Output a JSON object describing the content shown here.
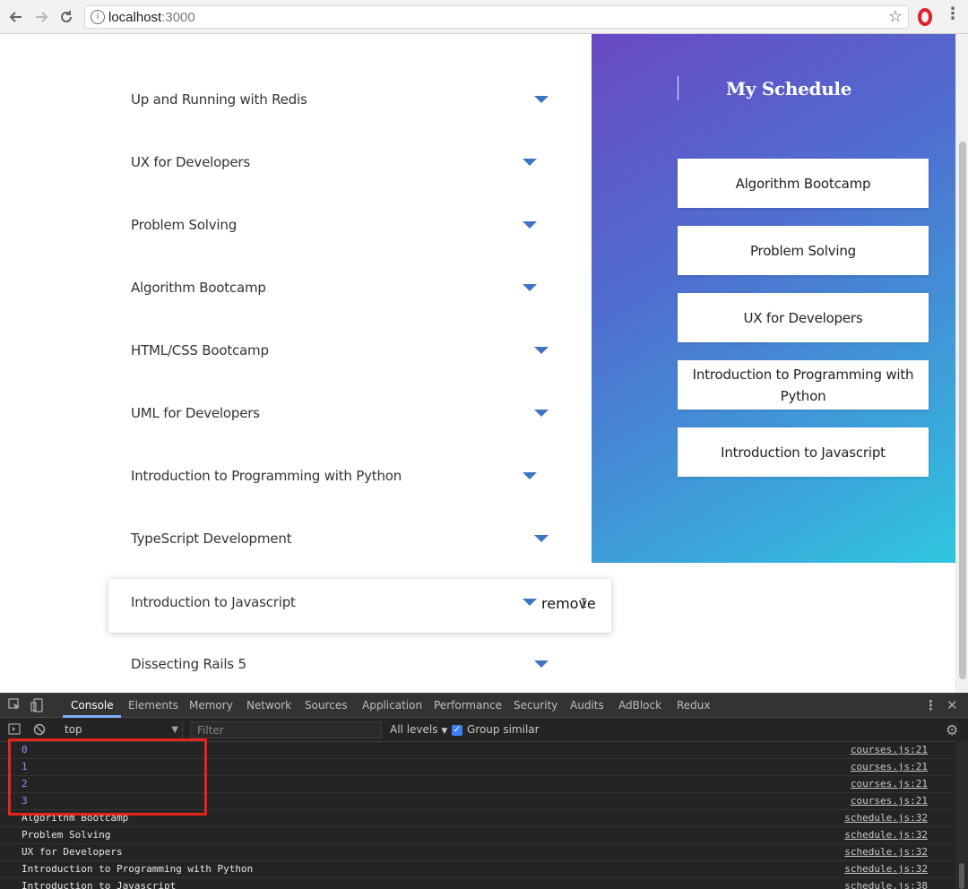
{
  "browser": {
    "url_host": "localhost",
    "url_port": ":3000",
    "back_icon": "back-arrow-icon",
    "forward_icon": "forward-arrow-icon",
    "reload_icon": "reload-icon"
  },
  "courses": [
    {
      "title": "Up and Running with Redis"
    },
    {
      "title": "UX for Developers"
    },
    {
      "title": "Problem Solving"
    },
    {
      "title": "Algorithm Bootcamp"
    },
    {
      "title": "HTML/CSS Bootcamp"
    },
    {
      "title": "UML for Developers"
    },
    {
      "title": "Introduction to Programming with Python"
    },
    {
      "title": "TypeScript Development"
    },
    {
      "title": "Introduction to Javascript",
      "hovered": true,
      "action_label": "remove"
    },
    {
      "title": "Dissecting Rails 5"
    }
  ],
  "schedule": {
    "heading": "My Schedule",
    "items": [
      "Algorithm Bootcamp",
      "Problem Solving",
      "UX for Developers",
      "Introduction to Programming with Python",
      "Introduction to Javascript"
    ]
  },
  "devtools": {
    "tabs": [
      "Console",
      "Elements",
      "Memory",
      "Network",
      "Sources",
      "Application",
      "Performance",
      "Security",
      "Audits",
      "AdBlock",
      "Redux"
    ],
    "active_tab": "Console",
    "context": "top",
    "filter_placeholder": "Filter",
    "levels_label": "All levels",
    "group_similar_label": "Group similar",
    "group_similar_checked": true,
    "logs": [
      {
        "message": "0",
        "source": "courses.js:21",
        "numeric": true
      },
      {
        "message": "1",
        "source": "courses.js:21",
        "numeric": true
      },
      {
        "message": "2",
        "source": "courses.js:21",
        "numeric": true
      },
      {
        "message": "3",
        "source": "courses.js:21",
        "numeric": true
      },
      {
        "message": "Algorithm Bootcamp",
        "source": "schedule.js:32"
      },
      {
        "message": "Problem Solving",
        "source": "schedule.js:32"
      },
      {
        "message": "UX for Developers",
        "source": "schedule.js:32"
      },
      {
        "message": "Introduction to Programming with Python",
        "source": "schedule.js:32"
      },
      {
        "message": "Introduction to Javascript",
        "source": "schedule.js:38"
      }
    ]
  },
  "colors": {
    "accent_arrow": "#3f74c5",
    "highlight": "#e8231b",
    "gradient_start": "#6949c5",
    "gradient_end": "#2fc7df"
  }
}
